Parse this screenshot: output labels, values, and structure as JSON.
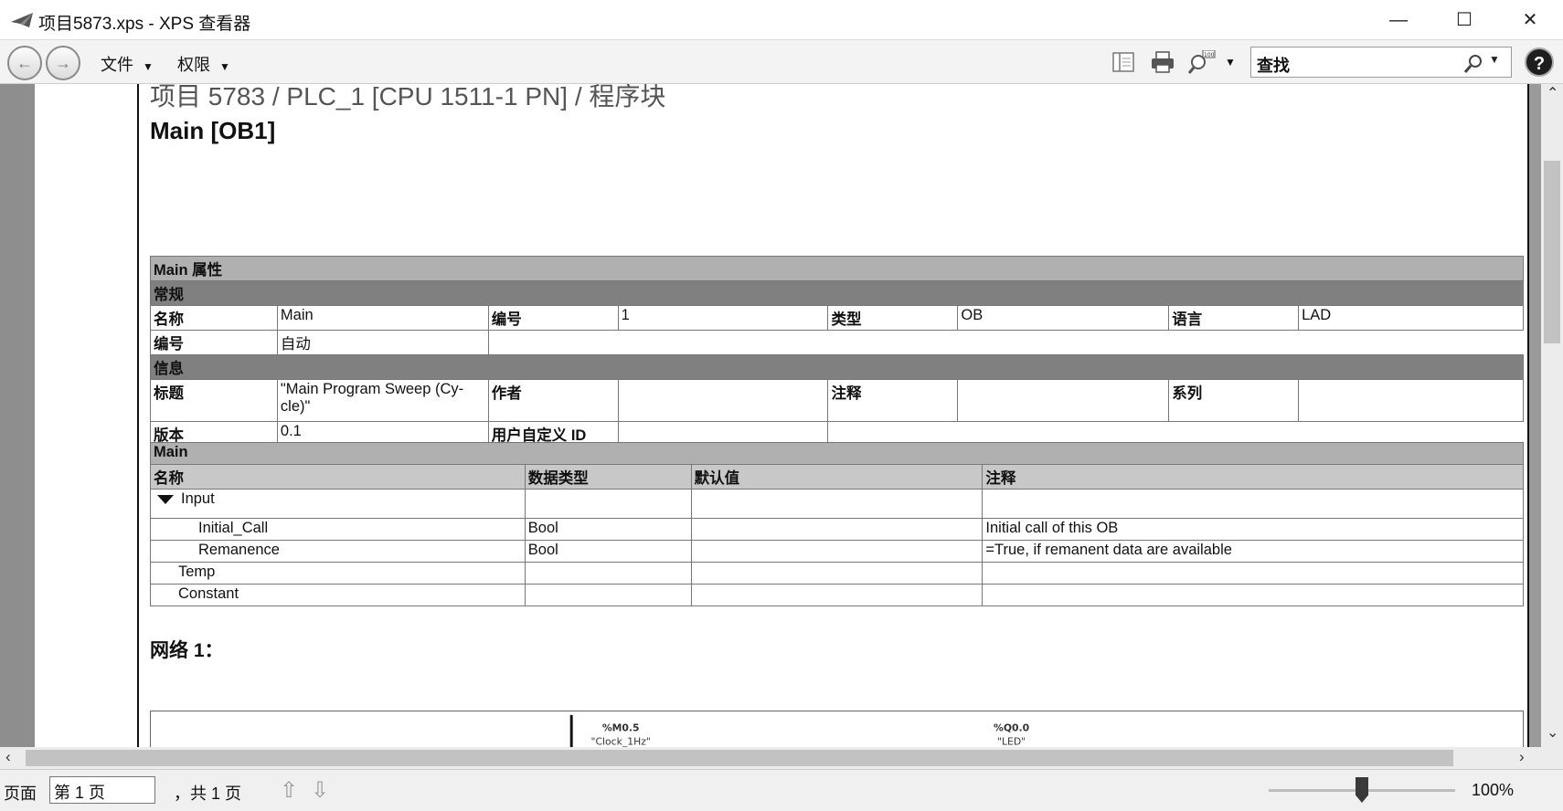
{
  "window": {
    "title": "项目5873.xps - XPS 查看器",
    "minimize": "—",
    "maximize": "☐",
    "close": "✕"
  },
  "toolbar": {
    "back": "←",
    "forward": "→",
    "menu_file": "文件",
    "menu_permissions": "权限",
    "search_value": "查找",
    "help": "?"
  },
  "document": {
    "breadcrumb": "项目 5783 / PLC_1 [CPU 1511-1 PN] / 程序块",
    "block_title": "Main [OB1]",
    "properties": {
      "section_title": "Main 属性",
      "general_title": "常规",
      "name_label": "名称",
      "name_value": "Main",
      "number_label": "编号",
      "number_value": "1",
      "type_label": "类型",
      "type_value": "OB",
      "language_label": "语言",
      "language_value": "LAD",
      "numbering_label": "编号",
      "numbering_value": "自动",
      "info_title": "信息",
      "title_label": "标题",
      "title_value": "\"Main Program Sweep (Cy-cle)\"",
      "author_label": "作者",
      "author_value": "",
      "comment_label": "注释",
      "comment_value": "",
      "family_label": "系列",
      "family_value": "",
      "version_label": "版本",
      "version_value": "0.1",
      "user_id_label": "用户自定义 ID",
      "user_id_value": ""
    },
    "interface": {
      "section_title": "Main",
      "columns": [
        "名称",
        "数据类型",
        "默认值",
        "注释"
      ],
      "rows": [
        {
          "name": "Input",
          "type": "",
          "default": "",
          "comment": ""
        },
        {
          "name": "Initial_Call",
          "type": "Bool",
          "default": "",
          "comment": "Initial call of this OB"
        },
        {
          "name": "Remanence",
          "type": "Bool",
          "default": "",
          "comment": "=True, if remanent data are available"
        },
        {
          "name": "Temp",
          "type": "",
          "default": "",
          "comment": ""
        },
        {
          "name": "Constant",
          "type": "",
          "default": "",
          "comment": ""
        }
      ]
    },
    "network": {
      "title": "网络 1：",
      "contact_address": "%M0.5",
      "contact_tag": "\"Clock_1Hz\"",
      "coil_address": "%Q0.0",
      "coil_tag": "\"LED\""
    }
  },
  "statusbar": {
    "page_label": "页面",
    "page_input": "第 1 页",
    "page_total": "，共 1 页",
    "zoom_fraction": 0.5,
    "zoom": "100%"
  }
}
